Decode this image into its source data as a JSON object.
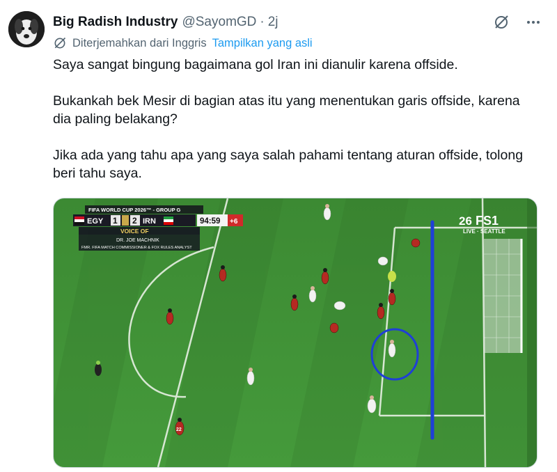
{
  "tweet": {
    "author_name": "Big Radish Industry",
    "author_handle": "@SayomGD",
    "separator": "·",
    "time": "2j",
    "translation_label": "Diterjemahkan dari Inggris",
    "show_original_label": "Tampilkan yang asli",
    "paragraphs": [
      "Saya sangat bingung bagaimana gol Iran ini dianulir karena offside.",
      "Bukankah bek Mesir di bagian atas itu yang menentukan garis offside, karena dia paling belakang?",
      "Jika ada yang tahu apa yang saya salah pahami tentang aturan offside, tolong beri tahu saya."
    ],
    "icons": {
      "grok": "grok-icon",
      "more": "more-icon",
      "translate": "translate-icon"
    }
  },
  "broadcast": {
    "competition": "FIFA WORLD CUP 2026™ - GROUP G",
    "home_team": "EGY",
    "home_score": "1",
    "away_team": "IRN",
    "away_score": "2",
    "clock": "94:59",
    "added_time": "+6",
    "voice_label": "VOICE OF",
    "analyst_name": "DR. JOE MACHNIK",
    "analyst_title": "FMR. FIFA MATCH COMMISSIONER & FOX RULES ANALYST",
    "network": "FS1",
    "live_label": "LIVE · SEATTLE",
    "player_number": "22",
    "colors": {
      "pitch": "#3f8a35",
      "offside_line": "#1f3fd6",
      "egypt_kit": "#b52a22",
      "iran_kit": "#f2f2f2"
    }
  }
}
